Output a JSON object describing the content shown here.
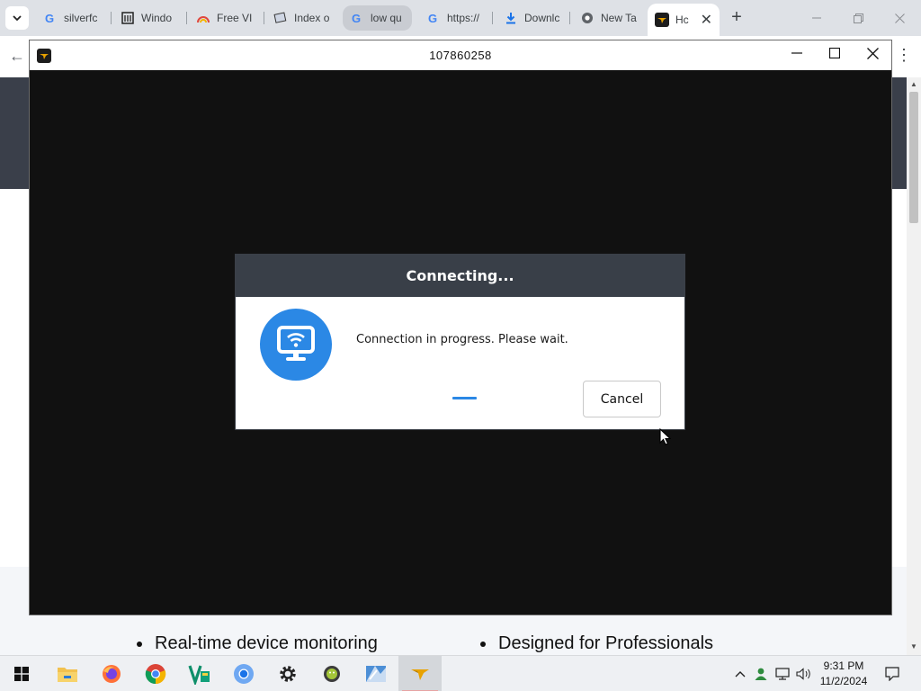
{
  "browser": {
    "tabs": [
      {
        "label": "silverfc",
        "icon": "google-icon"
      },
      {
        "label": "Windo",
        "icon": "windows-archive-icon"
      },
      {
        "label": "Free VI",
        "icon": "rainbow-icon"
      },
      {
        "label": "Index o",
        "icon": "index-icon"
      },
      {
        "label": "low qu",
        "icon": "google-icon"
      },
      {
        "label": "https://",
        "icon": "google-icon"
      },
      {
        "label": "Downlc",
        "icon": "download-icon"
      },
      {
        "label": "New Ta",
        "icon": "chrome-icon"
      },
      {
        "label": "Hc",
        "icon": "anydesk-icon"
      }
    ],
    "new_tab_label": "+",
    "back_label": "←",
    "menu_label": "⋮"
  },
  "page": {
    "features": [
      "Real-time device monitoring",
      "Designed for Professionals"
    ]
  },
  "session": {
    "title": "107860258",
    "minimize_label": "—",
    "maximize_label": "☐",
    "close_label": "✕"
  },
  "dialog": {
    "title": "Connecting...",
    "message": "Connection in progress. Please wait.",
    "cancel_label": "Cancel",
    "icon": "monitor-wifi-icon"
  },
  "taskbar": {
    "apps": [
      "start-icon",
      "file-explorer-icon",
      "firefox-icon",
      "chrome-icon",
      "vectr-icon",
      "chromium-icon",
      "settings-icon",
      "android-icon",
      "app-icon",
      "kangaroo-icon"
    ],
    "time": "9:31 PM",
    "date": "11/2/2024"
  },
  "colors": {
    "dialog_header": "#393f48",
    "accent_blue": "#2b88e5",
    "session_bg": "#111111"
  }
}
